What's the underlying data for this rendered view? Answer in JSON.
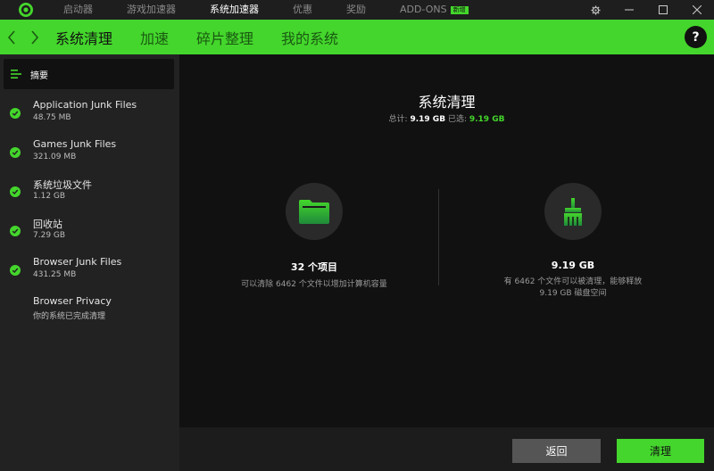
{
  "titlebar": {
    "nav": [
      {
        "label": "启动器"
      },
      {
        "label": "游戏加速器"
      },
      {
        "label": "系统加速器"
      },
      {
        "label": "优惠"
      },
      {
        "label": "奖励"
      },
      {
        "label": "ADD-ONS"
      }
    ],
    "addons_badge": "新增",
    "active_index": 2
  },
  "subnav": {
    "tabs": [
      {
        "label": "系统清理"
      },
      {
        "label": "加速"
      },
      {
        "label": "碎片整理"
      },
      {
        "label": "我的系统"
      }
    ],
    "help": "?"
  },
  "sidebar": {
    "summary_label": "摘要",
    "items": [
      {
        "title": "Application Junk Files",
        "sub": "48.75 MB",
        "checked": true
      },
      {
        "title": "Games Junk Files",
        "sub": "321.09 MB",
        "checked": true
      },
      {
        "title": "系统垃圾文件",
        "sub": "1.12 GB",
        "checked": true
      },
      {
        "title": "回收站",
        "sub": "7.29 GB",
        "checked": true
      },
      {
        "title": "Browser Junk Files",
        "sub": "431.25 MB",
        "checked": true
      },
      {
        "title": "Browser Privacy",
        "sub": "你的系统已完成清理",
        "checked": false
      }
    ]
  },
  "main": {
    "title": "系统清理",
    "total_label": "总计:",
    "total_value": "9.19 GB",
    "selected_label": "已选:",
    "selected_value": "9.19 GB",
    "left_card": {
      "icon": "folder-icon",
      "big": "32 个项目",
      "desc": "可以清除 6462 个文件以增加计算机容量"
    },
    "right_card": {
      "icon": "broom-icon",
      "big": "9.19 GB",
      "desc": "有 6462 个文件可以被清理，能够释放 9.19 GB 磁盘空间"
    }
  },
  "buttons": {
    "back": "返回",
    "clean": "清理"
  },
  "colors": {
    "accent": "#44d62c",
    "background": "#111111",
    "sidebar": "#222222"
  }
}
